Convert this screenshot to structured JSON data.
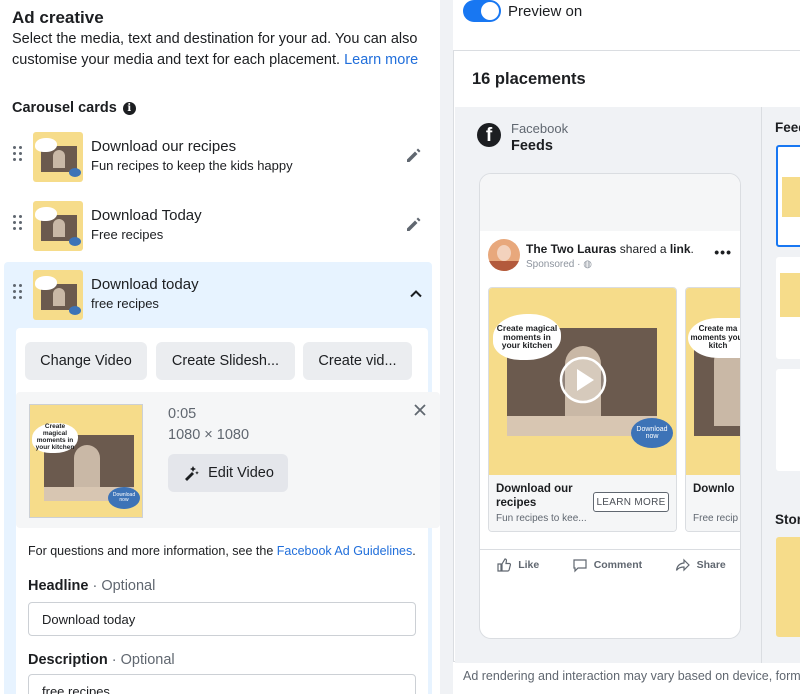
{
  "ad_creative": {
    "title": "Ad creative",
    "description": "Select the media, text and destination for your ad. You can also customise your media and text for each placement.",
    "learn_more": "Learn more"
  },
  "carousel": {
    "label": "Carousel cards",
    "cards": [
      {
        "title": "Download our recipes",
        "subtitle": "Fun recipes to keep the kids happy"
      },
      {
        "title": "Download Today",
        "subtitle": "Free recipes"
      },
      {
        "title": "Download today",
        "subtitle": "free recipes"
      }
    ]
  },
  "media_buttons": {
    "change_video": "Change Video",
    "create_slideshow": "Create Slidesh...",
    "create_video": "Create vid..."
  },
  "media": {
    "duration": "0:05",
    "dimensions": "1080 × 1080",
    "edit_video": "Edit Video",
    "image_caption": "Create magical moments in your kitchen",
    "image_badge": "Download now"
  },
  "guidelines": {
    "text": "For questions and more information, see the ",
    "link": "Facebook Ad Guidelines",
    "suffix": "."
  },
  "fields": {
    "headline_label": "Headline",
    "headline_optional": " · Optional",
    "headline_value": "Download today",
    "description_label": "Description",
    "description_optional": " · Optional",
    "description_value": "free recipes"
  },
  "preview": {
    "toggle_label": "Preview on",
    "toggle_on": true,
    "placements_title": "16 placements",
    "platform": "Facebook",
    "placement": "Feeds",
    "side_feed_label": "Feed",
    "side_stories_label": "Stor",
    "footer_note": "Ad rendering and interaction may vary based on device, forma"
  },
  "post": {
    "author": "The Two Lauras",
    "action_text": " shared a ",
    "link_word": "link",
    "period": ".",
    "sponsored": "Sponsored · ",
    "cards": [
      {
        "title": "Download our recipes",
        "subtitle": "Fun recipes to kee...",
        "cta": "LEARN MORE"
      },
      {
        "title": "Downlo",
        "subtitle": "Free recip"
      }
    ],
    "card_caption": "Create magical moments in your kitchen",
    "card2_caption": "Create ma moments your kitch",
    "badge": "Download now",
    "actions": [
      "Like",
      "Comment",
      "Share"
    ]
  },
  "colors": {
    "accent": "#1877f2",
    "link": "#216fdb",
    "expanded_bg": "#e7f3ff",
    "card_yellow": "#f6dc8a"
  }
}
